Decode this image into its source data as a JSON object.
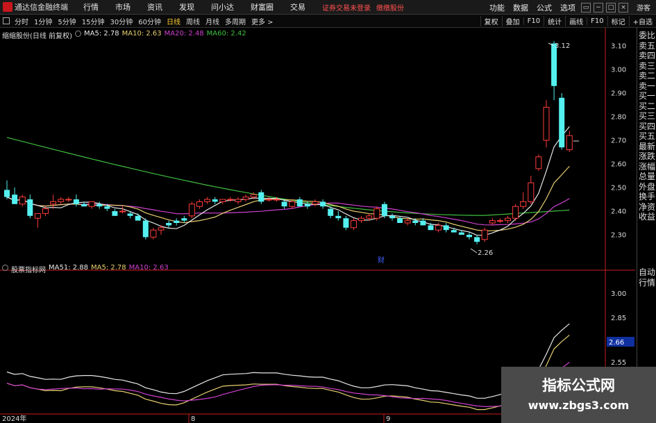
{
  "app": {
    "title": "通达信金融终端",
    "menu": [
      "行情",
      "市场",
      "资讯",
      "发现",
      "问小达",
      "财富圈",
      "交易"
    ],
    "login_status": "证券交易未登录",
    "broker": "缴缴股份",
    "right_menu": [
      "功能",
      "数据",
      "公式",
      "选项"
    ],
    "guest": "游客",
    "window_controls": [
      "▭",
      "−",
      "□",
      "×"
    ]
  },
  "periods": {
    "items": [
      "分时",
      "1分钟",
      "5分钟",
      "15分钟",
      "30分钟",
      "60分钟",
      "日线",
      "周线",
      "月线",
      "多周期",
      "更多 >"
    ],
    "active": "日线",
    "right_buttons": [
      "复权",
      "叠加",
      "F10",
      "统计",
      "画线",
      "F10",
      "标记",
      "+自选"
    ]
  },
  "legend_main": {
    "stock": "缩缩股份(日线 前复权)",
    "items": [
      {
        "label": "MA5: 2.78",
        "color": "#e8e8e8"
      },
      {
        "label": "MA10: 2.63",
        "color": "#e8d070"
      },
      {
        "label": "MA20: 2.48",
        "color": "#d040d0"
      },
      {
        "label": "MA60: 2.42",
        "color": "#40c040"
      }
    ]
  },
  "legend_sub": {
    "name": "股票指标网",
    "items": [
      {
        "label": "MA51: 2.88",
        "color": "#e8e8e8"
      },
      {
        "label": "MA5: 2.78",
        "color": "#e8d070"
      },
      {
        "label": "MA10: 2.63",
        "color": "#d040d0"
      }
    ]
  },
  "price_axis": {
    "ticks": [
      "3.10",
      "3.00",
      "2.90",
      "2.80",
      "2.70",
      "2.60",
      "2.50",
      "2.40",
      "2.30"
    ]
  },
  "sub_axis": {
    "ticks": [
      "3.00",
      "2.85",
      "2.55"
    ],
    "current": "2.66"
  },
  "annotations": {
    "high": "3.12",
    "low": "2.26",
    "finance_marker": "财"
  },
  "date_axis": {
    "labels": [
      "2024年",
      "8",
      "9"
    ]
  },
  "side_top": [
    "委比",
    "卖五",
    "卖四",
    "卖三",
    "卖二",
    "卖一",
    "买一",
    "买二",
    "买三",
    "买四",
    "买五",
    "最新",
    "涨跌",
    "涨幅",
    "总量",
    "外盘",
    "换手",
    "净资",
    "收益"
  ],
  "side_bottom": [
    "自动",
    "行情"
  ],
  "watermark": {
    "title": "指标公式网",
    "url": "www.zbgs3.com"
  },
  "chart_data": {
    "type": "candlestick",
    "candles": [
      {
        "o": 2.49,
        "h": 2.53,
        "l": 2.45,
        "c": 2.46
      },
      {
        "o": 2.47,
        "h": 2.5,
        "l": 2.43,
        "c": 2.43
      },
      {
        "o": 2.43,
        "h": 2.47,
        "l": 2.42,
        "c": 2.46
      },
      {
        "o": 2.45,
        "h": 2.47,
        "l": 2.37,
        "c": 2.38
      },
      {
        "o": 2.37,
        "h": 2.39,
        "l": 2.33,
        "c": 2.39
      },
      {
        "o": 2.39,
        "h": 2.42,
        "l": 2.38,
        "c": 2.41
      },
      {
        "o": 2.43,
        "h": 2.47,
        "l": 2.41,
        "c": 2.44
      },
      {
        "o": 2.44,
        "h": 2.46,
        "l": 2.43,
        "c": 2.45
      },
      {
        "o": 2.45,
        "h": 2.46,
        "l": 2.44,
        "c": 2.45
      },
      {
        "o": 2.45,
        "h": 2.47,
        "l": 2.42,
        "c": 2.43
      },
      {
        "o": 2.43,
        "h": 2.44,
        "l": 2.42,
        "c": 2.42
      },
      {
        "o": 2.42,
        "h": 2.44,
        "l": 2.41,
        "c": 2.44
      },
      {
        "o": 2.43,
        "h": 2.44,
        "l": 2.41,
        "c": 2.42
      },
      {
        "o": 2.42,
        "h": 2.43,
        "l": 2.4,
        "c": 2.41
      },
      {
        "o": 2.4,
        "h": 2.41,
        "l": 2.38,
        "c": 2.38
      },
      {
        "o": 2.4,
        "h": 2.42,
        "l": 2.39,
        "c": 2.4
      },
      {
        "o": 2.39,
        "h": 2.4,
        "l": 2.37,
        "c": 2.38
      },
      {
        "o": 2.38,
        "h": 2.39,
        "l": 2.36,
        "c": 2.36
      },
      {
        "o": 2.36,
        "h": 2.37,
        "l": 2.28,
        "c": 2.29
      },
      {
        "o": 2.29,
        "h": 2.33,
        "l": 2.28,
        "c": 2.32
      },
      {
        "o": 2.32,
        "h": 2.34,
        "l": 2.3,
        "c": 2.33
      },
      {
        "o": 2.35,
        "h": 2.36,
        "l": 2.33,
        "c": 2.34
      },
      {
        "o": 2.36,
        "h": 2.37,
        "l": 2.34,
        "c": 2.35
      },
      {
        "o": 2.37,
        "h": 2.38,
        "l": 2.35,
        "c": 2.36
      },
      {
        "o": 2.38,
        "h": 2.44,
        "l": 2.37,
        "c": 2.43
      },
      {
        "o": 2.42,
        "h": 2.45,
        "l": 2.41,
        "c": 2.44
      },
      {
        "o": 2.44,
        "h": 2.46,
        "l": 2.43,
        "c": 2.45
      },
      {
        "o": 2.45,
        "h": 2.46,
        "l": 2.43,
        "c": 2.44
      },
      {
        "o": 2.44,
        "h": 2.45,
        "l": 2.43,
        "c": 2.45
      },
      {
        "o": 2.45,
        "h": 2.46,
        "l": 2.44,
        "c": 2.45
      },
      {
        "o": 2.44,
        "h": 2.46,
        "l": 2.43,
        "c": 2.45
      },
      {
        "o": 2.45,
        "h": 2.47,
        "l": 2.44,
        "c": 2.46
      },
      {
        "o": 2.46,
        "h": 2.48,
        "l": 2.45,
        "c": 2.47
      },
      {
        "o": 2.48,
        "h": 2.49,
        "l": 2.43,
        "c": 2.44
      },
      {
        "o": 2.45,
        "h": 2.46,
        "l": 2.44,
        "c": 2.45
      },
      {
        "o": 2.45,
        "h": 2.46,
        "l": 2.44,
        "c": 2.45
      },
      {
        "o": 2.44,
        "h": 2.45,
        "l": 2.41,
        "c": 2.42
      },
      {
        "o": 2.42,
        "h": 2.45,
        "l": 2.41,
        "c": 2.44
      },
      {
        "o": 2.45,
        "h": 2.46,
        "l": 2.42,
        "c": 2.42
      },
      {
        "o": 2.43,
        "h": 2.44,
        "l": 2.41,
        "c": 2.42
      },
      {
        "o": 2.43,
        "h": 2.45,
        "l": 2.42,
        "c": 2.44
      },
      {
        "o": 2.44,
        "h": 2.45,
        "l": 2.41,
        "c": 2.42
      },
      {
        "o": 2.41,
        "h": 2.42,
        "l": 2.37,
        "c": 2.38
      },
      {
        "o": 2.38,
        "h": 2.4,
        "l": 2.36,
        "c": 2.37
      },
      {
        "o": 2.37,
        "h": 2.38,
        "l": 2.32,
        "c": 2.33
      },
      {
        "o": 2.33,
        "h": 2.37,
        "l": 2.32,
        "c": 2.36
      },
      {
        "o": 2.36,
        "h": 2.38,
        "l": 2.35,
        "c": 2.37
      },
      {
        "o": 2.37,
        "h": 2.39,
        "l": 2.36,
        "c": 2.38
      },
      {
        "o": 2.37,
        "h": 2.42,
        "l": 2.36,
        "c": 2.41
      },
      {
        "o": 2.43,
        "h": 2.44,
        "l": 2.37,
        "c": 2.38
      },
      {
        "o": 2.38,
        "h": 2.39,
        "l": 2.36,
        "c": 2.37
      },
      {
        "o": 2.37,
        "h": 2.38,
        "l": 2.35,
        "c": 2.35
      },
      {
        "o": 2.35,
        "h": 2.37,
        "l": 2.34,
        "c": 2.36
      },
      {
        "o": 2.36,
        "h": 2.37,
        "l": 2.34,
        "c": 2.35
      },
      {
        "o": 2.36,
        "h": 2.37,
        "l": 2.34,
        "c": 2.34
      },
      {
        "o": 2.34,
        "h": 2.35,
        "l": 2.32,
        "c": 2.32
      },
      {
        "o": 2.32,
        "h": 2.35,
        "l": 2.31,
        "c": 2.34
      },
      {
        "o": 2.34,
        "h": 2.35,
        "l": 2.31,
        "c": 2.32
      },
      {
        "o": 2.32,
        "h": 2.33,
        "l": 2.31,
        "c": 2.31
      },
      {
        "o": 2.31,
        "h": 2.32,
        "l": 2.3,
        "c": 2.3
      },
      {
        "o": 2.3,
        "h": 2.31,
        "l": 2.28,
        "c": 2.29
      },
      {
        "o": 2.29,
        "h": 2.3,
        "l": 2.26,
        "c": 2.27
      },
      {
        "o": 2.28,
        "h": 2.33,
        "l": 2.27,
        "c": 2.32
      },
      {
        "o": 2.35,
        "h": 2.37,
        "l": 2.34,
        "c": 2.36
      },
      {
        "o": 2.36,
        "h": 2.37,
        "l": 2.35,
        "c": 2.36
      },
      {
        "o": 2.36,
        "h": 2.38,
        "l": 2.35,
        "c": 2.37
      },
      {
        "o": 2.37,
        "h": 2.43,
        "l": 2.36,
        "c": 2.42
      },
      {
        "o": 2.42,
        "h": 2.48,
        "l": 2.41,
        "c": 2.44
      },
      {
        "o": 2.44,
        "h": 2.55,
        "l": 2.43,
        "c": 2.52
      },
      {
        "o": 2.58,
        "h": 2.64,
        "l": 2.57,
        "c": 2.63
      },
      {
        "o": 2.7,
        "h": 2.87,
        "l": 2.67,
        "c": 2.84
      },
      {
        "o": 3.11,
        "h": 3.12,
        "l": 2.87,
        "c": 2.93
      },
      {
        "o": 2.88,
        "h": 2.9,
        "l": 2.66,
        "c": 2.67
      },
      {
        "o": 2.66,
        "h": 2.74,
        "l": 2.65,
        "c": 2.72
      }
    ]
  }
}
